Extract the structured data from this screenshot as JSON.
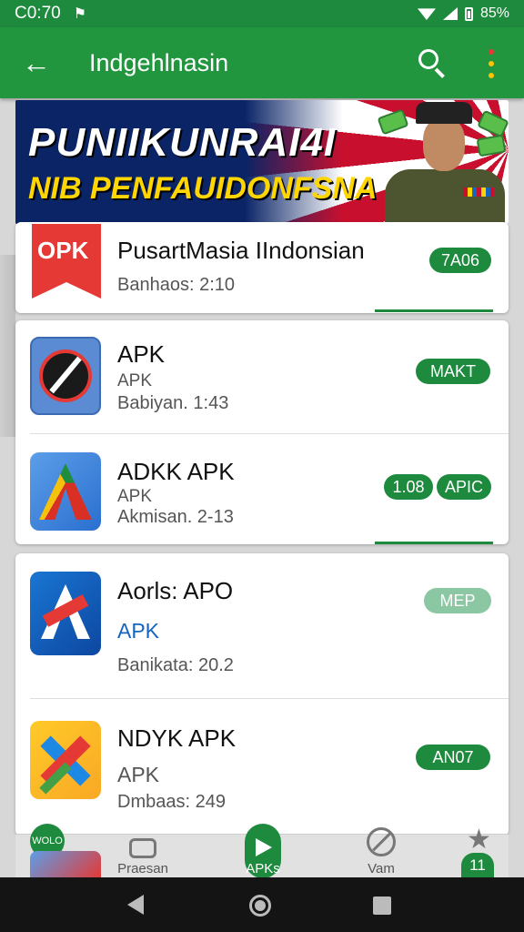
{
  "status_bar": {
    "time": "C0:70",
    "notif_icon": "bell-icon",
    "battery": "85%"
  },
  "app_bar": {
    "back_icon": "←",
    "title": "Indgehlnasin"
  },
  "banner": {
    "line1": "PUNIIKUNRAI4I",
    "line2": "NIB PENFAUIDONFSNA"
  },
  "featured": {
    "icon_text": "OPK",
    "name": "PusartMasia IIndonsian",
    "meta": "Banhaos: 2:10",
    "badge": "7A06"
  },
  "list_group1": [
    {
      "name": "APK",
      "sub": "APK",
      "meta": "Babiyan. 1:43",
      "badges": [
        "MAKT"
      ]
    },
    {
      "name": "ADKK APK",
      "sub": "APK",
      "meta": "Akmisan. 2-13",
      "badges": [
        "1.08",
        "APIC"
      ]
    }
  ],
  "list_group2": [
    {
      "name": "Aorls: APO",
      "sub": "APK",
      "meta": "Banikata: 20.2",
      "badges": [
        "MEP"
      ]
    },
    {
      "name": "NDYK APK",
      "sub": "APK",
      "meta": "Dmbaas: 249",
      "badges": [
        "AN07"
      ]
    }
  ],
  "bottom_nav": {
    "items": [
      {
        "label": "Praesan",
        "icon": "camera-icon"
      },
      {
        "label": "APKs",
        "icon": "play-icon"
      },
      {
        "label": "Vam",
        "icon": "compass-icon"
      }
    ],
    "left_badge": "WOLO",
    "right_badge": "11"
  },
  "colors": {
    "primary": "#21963f",
    "status": "#1e8a3e",
    "banner_bg": "#0d2b73",
    "accent_red": "#c8102e"
  }
}
